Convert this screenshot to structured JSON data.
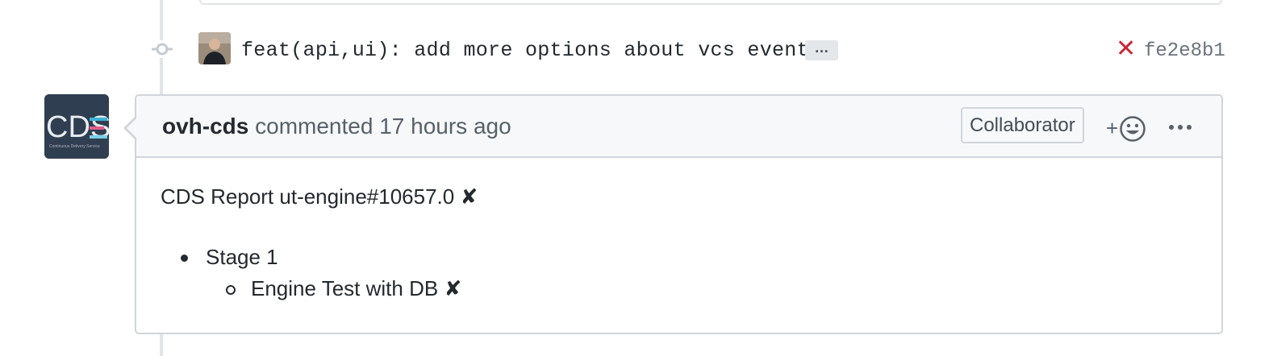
{
  "commit": {
    "message": "feat(api,ui): add more options about vcs events",
    "ellipsis_label": "…",
    "status_icon": "x-icon",
    "status_symbol": "✕",
    "status_color": "#cb2431",
    "sha": "fe2e8b1"
  },
  "comment": {
    "author": "ovh-cds",
    "action": "commented",
    "timestamp": "17 hours ago",
    "role_badge": "Collaborator",
    "reaction_plus": "+",
    "avatar_logo_text": "CDS",
    "avatar_logo_subtitle": "Continuous Delivery Service",
    "body": {
      "title": "CDS Report ut-engine#10657.0",
      "title_mark": "✘",
      "stages": [
        {
          "name": "Stage 1",
          "jobs": [
            {
              "name": "Engine Test with DB",
              "mark": "✘"
            }
          ]
        }
      ]
    }
  }
}
